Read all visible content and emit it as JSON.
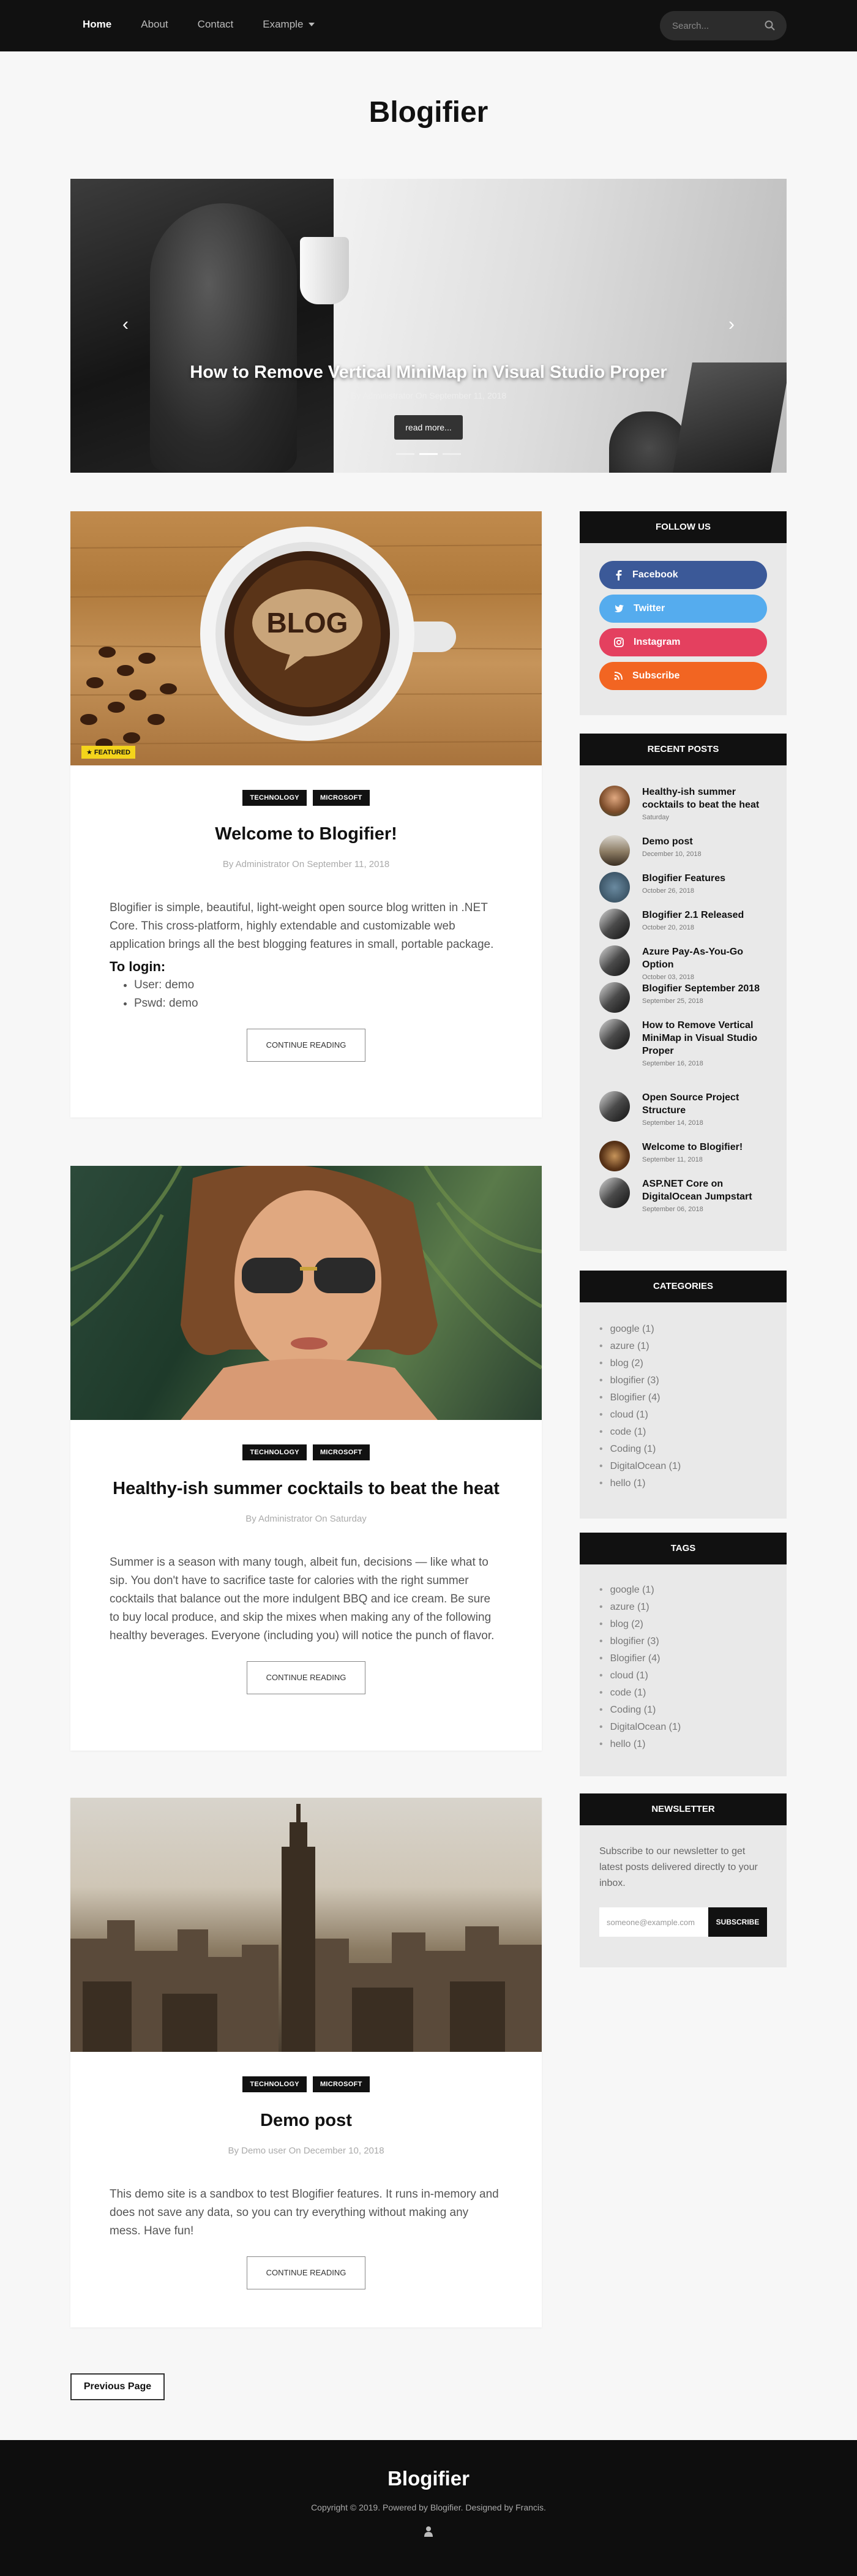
{
  "nav": {
    "links": [
      {
        "label": "Home",
        "active": true
      },
      {
        "label": "About"
      },
      {
        "label": "Contact"
      },
      {
        "label": "Example"
      }
    ],
    "search_placeholder": "Search..."
  },
  "site_title": "Blogifier",
  "hero": {
    "title": "How to Remove Vertical MiniMap in Visual Studio Proper",
    "meta": "By Administrator On September 11, 2018",
    "button": "read more...",
    "prev_glyph": "‹",
    "next_glyph": "›"
  },
  "posts": [
    {
      "tags": [
        "TECHNOLOGY",
        "MICROSOFT"
      ],
      "featured": "FEATURED",
      "image_text": "BLOG",
      "title": "Welcome to Blogifier!",
      "meta": "By Administrator On September 11, 2018",
      "excerpt": "Blogifier is simple, beautiful, light-weight open source blog written in .NET Core. This cross-platform, highly extendable and customizable web application brings all the best blogging features in small, portable package.",
      "login_heading": "To login:",
      "login_items": [
        "User: demo",
        "Pswd: demo"
      ],
      "button": "CONTINUE READING"
    },
    {
      "tags": [
        "TECHNOLOGY",
        "MICROSOFT"
      ],
      "title": "Healthy-ish summer cocktails to beat the heat",
      "meta": "By Administrator On Saturday",
      "excerpt": "Summer is a season with many tough, albeit fun, decisions — like what to sip. You don't have to sacrifice taste for calories with the right summer cocktails that balance out the more indulgent BBQ and ice cream. Be sure to buy local produce, and skip the mixes when making any of the following healthy beverages. Everyone (including you) will notice the punch of flavor.",
      "button": "CONTINUE READING"
    },
    {
      "tags": [
        "TECHNOLOGY",
        "MICROSOFT"
      ],
      "title": "Demo post",
      "meta": "By Demo user On December 10, 2018",
      "excerpt": "This demo site is a sandbox to test Blogifier features. It runs in-memory and does not save any data, so you can try everything without making any mess. Have fun!",
      "button": "CONTINUE READING"
    }
  ],
  "sidebar": {
    "follow": {
      "heading": "FOLLOW US",
      "items": [
        {
          "label": "Facebook",
          "icon": "facebook-icon",
          "color": "#3b5998"
        },
        {
          "label": "Twitter",
          "icon": "twitter-icon",
          "color": "#55acee"
        },
        {
          "label": "Instagram",
          "icon": "instagram-icon",
          "color": "#e4405f"
        },
        {
          "label": "Subscribe",
          "icon": "rss-icon",
          "color": "#f26522"
        }
      ]
    },
    "recent": {
      "heading": "RECENT POSTS",
      "items": [
        {
          "title": "Healthy-ish summer cocktails to beat the heat",
          "date": "Saturday"
        },
        {
          "title": "Demo post",
          "date": "December 10, 2018"
        },
        {
          "title": "Blogifier Features",
          "date": "October 26, 2018"
        },
        {
          "title": "Blogifier 2.1 Released",
          "date": "October 20, 2018"
        },
        {
          "title": "Azure Pay-As-You-Go Option",
          "date": "October 03, 2018"
        },
        {
          "title": "Blogifier September 2018",
          "date": "September 25, 2018"
        },
        {
          "title": "How to Remove Vertical MiniMap in Visual Studio Proper",
          "date": "September 16, 2018"
        },
        {
          "title": "Open Source Project Structure",
          "date": "September 14, 2018"
        },
        {
          "title": "Welcome to Blogifier!",
          "date": "September 11, 2018"
        },
        {
          "title": "ASP.NET Core on DigitalOcean Jumpstart",
          "date": "September 06, 2018"
        }
      ]
    },
    "categories": {
      "heading": "CATEGORIES",
      "items": [
        "google (1)",
        "azure (1)",
        "blog (2)",
        "blogifier (3)",
        "Blogifier (4)",
        "cloud (1)",
        "code (1)",
        "Coding (1)",
        "DigitalOcean (1)",
        "hello (1)"
      ]
    },
    "tags": {
      "heading": "TAGS",
      "items": [
        "google (1)",
        "azure (1)",
        "blog (2)",
        "blogifier (3)",
        "Blogifier (4)",
        "cloud (1)",
        "code (1)",
        "Coding (1)",
        "DigitalOcean (1)",
        "hello (1)"
      ]
    },
    "newsletter": {
      "heading": "NEWSLETTER",
      "text": "Subscribe to our newsletter to get latest posts delivered directly to your inbox.",
      "placeholder": "someone@example.com",
      "button": "SUBSCRIBE"
    }
  },
  "pagination": {
    "prev": "Previous Page"
  },
  "footer": {
    "title": "Blogifier",
    "copyright": "Copyright © 2019. Powered by Blogifier. Designed by Francis.",
    "icon": "user-icon"
  }
}
